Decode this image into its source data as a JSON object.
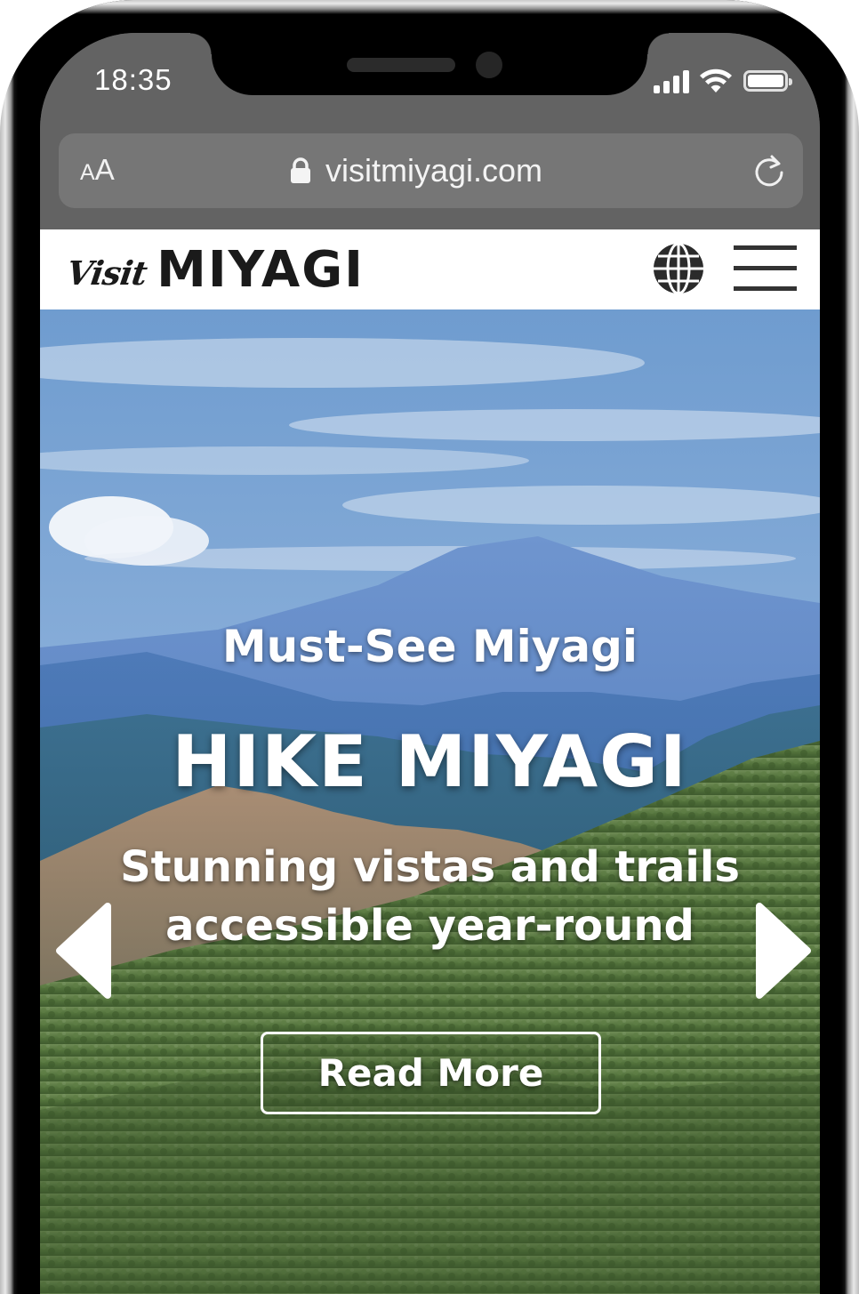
{
  "status_bar": {
    "time": "18:35",
    "icons": [
      "cellular-signal-icon",
      "wifi-icon",
      "battery-icon"
    ]
  },
  "browser": {
    "text_size_label_small": "A",
    "text_size_label_large": "A",
    "url": "visitmiyagi.com",
    "icons": [
      "lock-icon",
      "reload-icon"
    ]
  },
  "site_header": {
    "logo_visit": "Visit",
    "logo_miyagi": "MIYAGI",
    "icons": [
      "globe-icon",
      "hamburger-menu-icon"
    ]
  },
  "hero": {
    "eyebrow": "Must-See Miyagi",
    "title": "HIKE MIYAGI",
    "subtitle_line1": "Stunning vistas and trails",
    "subtitle_line2": "accessible year-round",
    "cta_label": "Read More",
    "icons": [
      "arrow-left-icon",
      "arrow-right-icon"
    ]
  },
  "colors": {
    "browser_chrome": "#636363",
    "address_bar": "#767676",
    "header_bg": "#ffffff",
    "logo_text": "#1a1a1a",
    "hero_text": "#ffffff"
  }
}
